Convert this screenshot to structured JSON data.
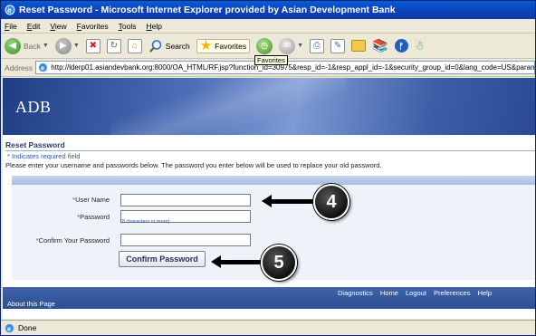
{
  "window": {
    "title": "Reset Password - Microsoft Internet Explorer provided by Asian Development Bank"
  },
  "menu": {
    "items": [
      "File",
      "Edit",
      "View",
      "Favorites",
      "Tools",
      "Help"
    ]
  },
  "toolbar": {
    "back_label": "Back",
    "search_label": "Search",
    "favorites_label": "Favorites",
    "tooltip": "Favorites"
  },
  "address": {
    "label": "Address",
    "url": "http://lderp01.asiandevbank.org:8000/OA_HTML/RF.jsp?function_id=30975&resp_id=-1&resp_appl_id=-1&security_group_id=0&lang_code=US&params=f"
  },
  "page": {
    "logo": "ADB",
    "title": "Reset Password",
    "required_note": "* Indicates required field",
    "instructions": "Please enter your username and passwords below. The password you enter below will be used to replace your old password.",
    "fields": {
      "username_label": "User Name",
      "password_label": "Password",
      "password_hint": "(8 characters or more)",
      "confirm_label": "Confirm Your Password",
      "required_mark": "*"
    },
    "confirm_button": "Confirm Password",
    "footer_links": [
      "Diagnostics",
      "Home",
      "Logout",
      "Preferences",
      "Help"
    ],
    "about": "About this Page"
  },
  "callouts": {
    "first": "4",
    "second": "5"
  },
  "status": {
    "text": "Done"
  },
  "colors": {
    "title_bar": "#0b3fb5",
    "banner": "#3d5fa7",
    "footer": "#2d4f93",
    "link": "#2c56a8"
  }
}
